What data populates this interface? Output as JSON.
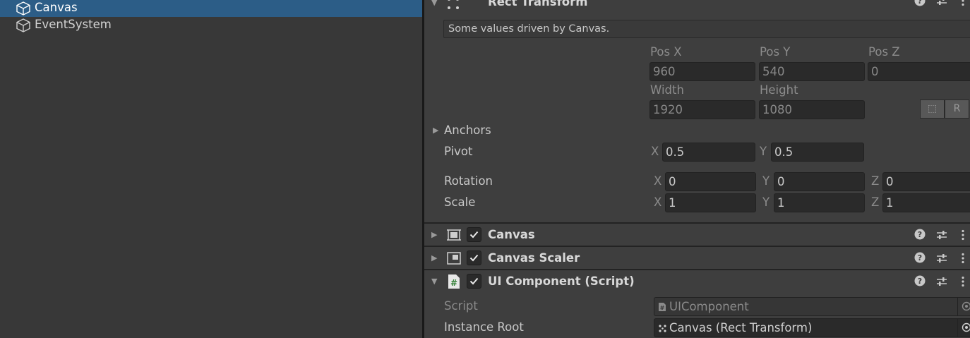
{
  "hierarchy": {
    "items": [
      {
        "label": "Canvas",
        "selected": true
      },
      {
        "label": "EventSystem",
        "selected": false
      }
    ]
  },
  "inspector": {
    "rect_transform": {
      "title": "Rect Transform",
      "note": "Some values driven by Canvas.",
      "headers": {
        "pos_x": "Pos X",
        "pos_y": "Pos Y",
        "pos_z": "Pos Z",
        "width": "Width",
        "height": "Height"
      },
      "pos_x": "960",
      "pos_y": "540",
      "pos_z": "0",
      "width": "1920",
      "height": "1080",
      "blueprint_button": "⬚",
      "raw_button": "R",
      "anchors_label": "Anchors",
      "pivot": {
        "label": "Pivot",
        "x_axis": "X",
        "y_axis": "Y",
        "x": "0.5",
        "y": "0.5"
      },
      "rotation": {
        "label": "Rotation",
        "x_axis": "X",
        "y_axis": "Y",
        "z_axis": "Z",
        "x": "0",
        "y": "0",
        "z": "0"
      },
      "scale": {
        "label": "Scale",
        "x_axis": "X",
        "y_axis": "Y",
        "z_axis": "Z",
        "x": "1",
        "y": "1",
        "z": "1"
      }
    },
    "components": [
      {
        "title": "Canvas",
        "enabled": true,
        "expanded": false
      },
      {
        "title": "Canvas Scaler",
        "enabled": true,
        "expanded": false
      },
      {
        "title": "UI Component (Script)",
        "enabled": true,
        "expanded": true
      }
    ],
    "ui_component": {
      "script_label": "Script",
      "script_value": "UIComponent",
      "instance_root_label": "Instance Root",
      "instance_root_value": "Canvas (Rect Transform)"
    },
    "header_tools": {
      "help": "?",
      "presets": "⇵",
      "menu": "⋮"
    }
  },
  "colors": {
    "selection": "#2c5d87",
    "panel": "#383838",
    "inspector": "#3e3e3e",
    "field": "#2a2a2a"
  }
}
